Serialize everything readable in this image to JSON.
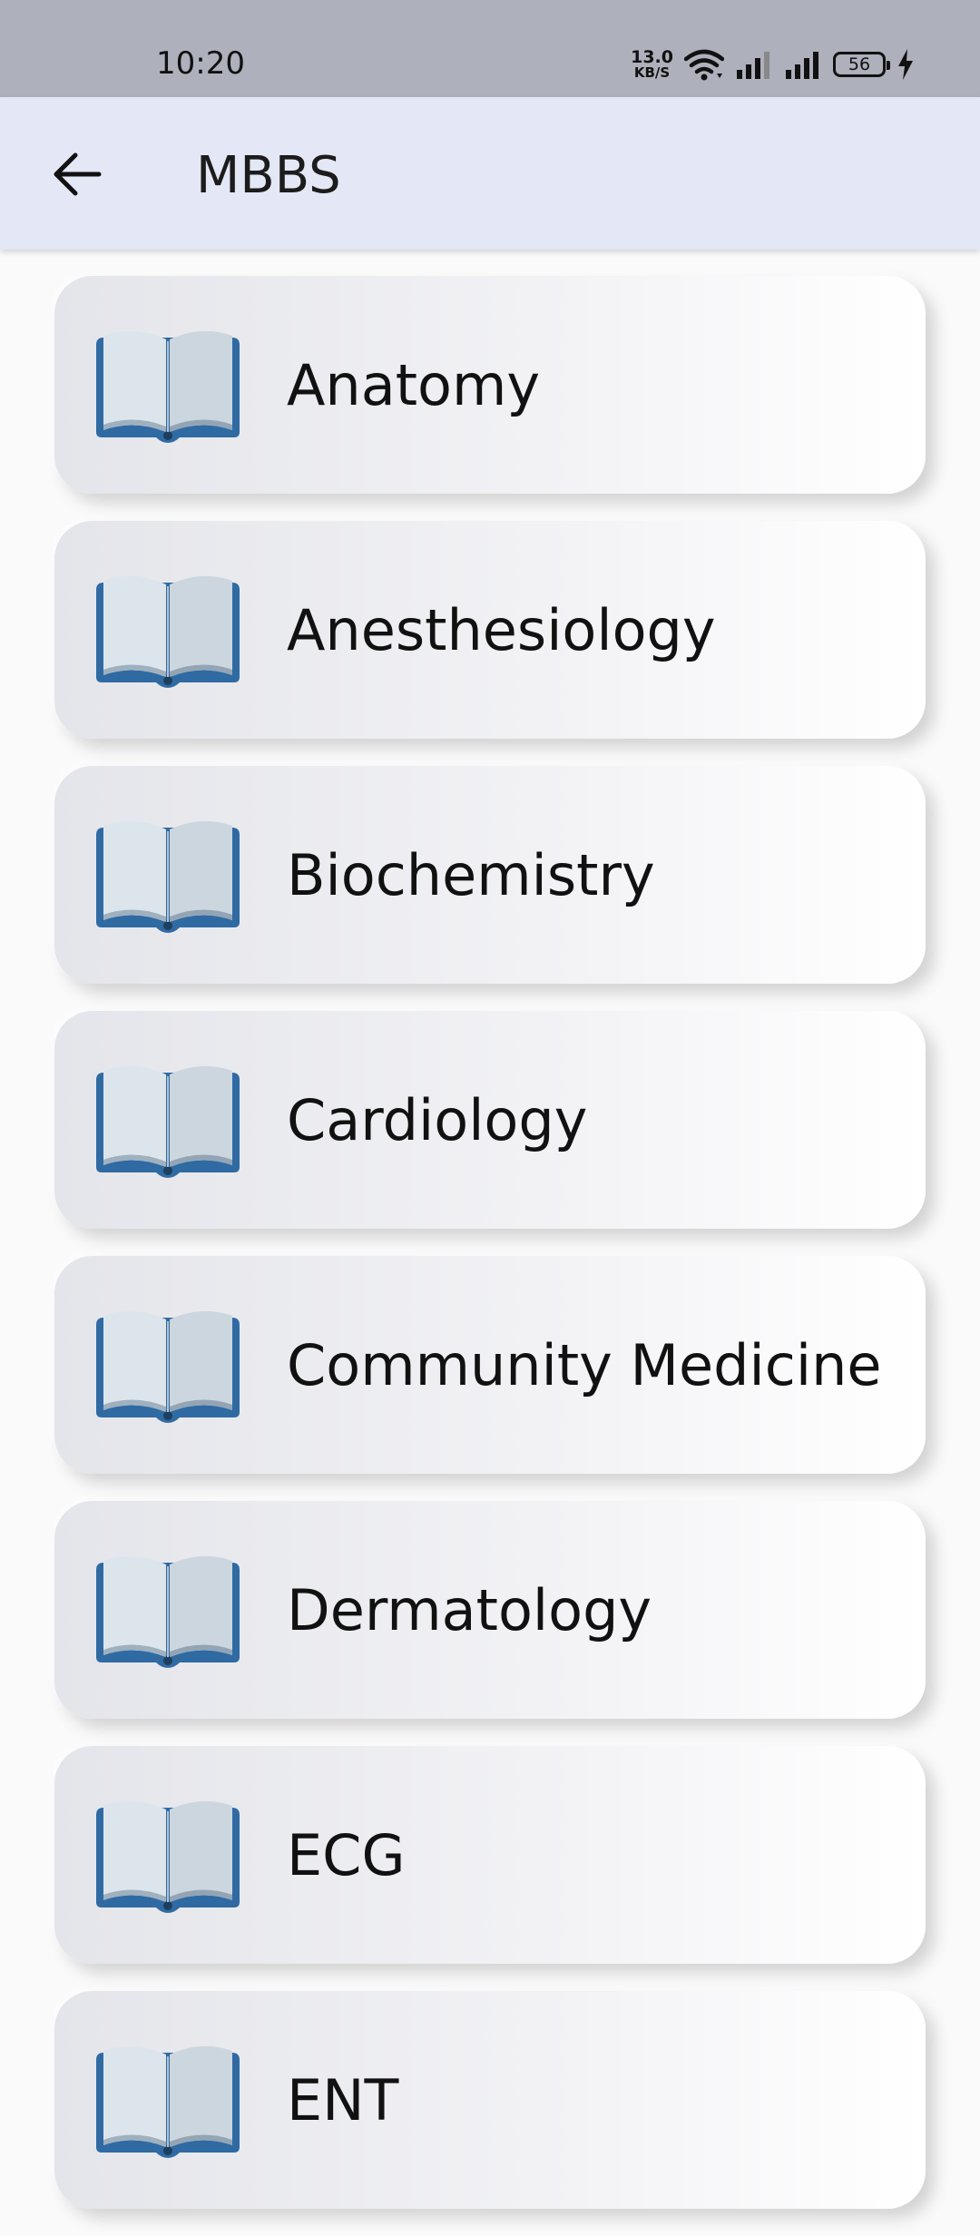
{
  "status_bar": {
    "time": "10:20",
    "net_speed_value": "13.0",
    "net_speed_unit": "KB/S",
    "battery": "56"
  },
  "app_bar": {
    "title": "MBBS"
  },
  "subjects": [
    {
      "label": "Anatomy"
    },
    {
      "label": "Anesthesiology"
    },
    {
      "label": "Biochemistry"
    },
    {
      "label": "Cardiology"
    },
    {
      "label": "Community Medicine"
    },
    {
      "label": "Dermatology"
    },
    {
      "label": "ECG"
    },
    {
      "label": "ENT"
    }
  ],
  "colors": {
    "status_bar_bg": "#aeb0bb",
    "app_bar_bg": "#e4e7f5",
    "book_cover": "#2f6aa3",
    "book_page": "#dbe3ea"
  }
}
